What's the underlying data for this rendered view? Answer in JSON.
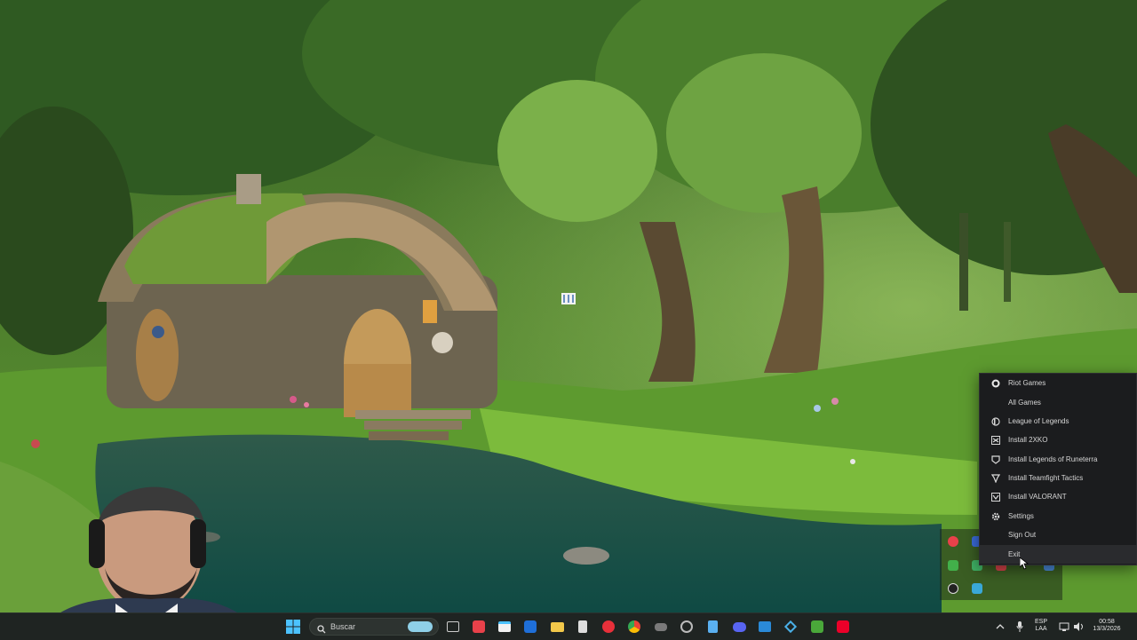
{
  "menu": {
    "items": [
      {
        "label": "Riot Games",
        "icon": "riot-fist-icon"
      },
      {
        "label": "All Games",
        "icon": ""
      },
      {
        "label": "League of Legends",
        "icon": "league-icon"
      },
      {
        "label": "Install 2XKO",
        "icon": "2xko-icon"
      },
      {
        "label": "Install Legends of Runeterra",
        "icon": "runeterra-icon"
      },
      {
        "label": "Install Teamfight Tactics",
        "icon": "tft-icon"
      },
      {
        "label": "Install VALORANT",
        "icon": "valorant-icon"
      },
      {
        "label": "Settings",
        "icon": "gear-icon"
      },
      {
        "label": "Sign Out",
        "icon": ""
      },
      {
        "label": "Exit",
        "icon": ""
      }
    ]
  },
  "taskbar": {
    "search_label": "Buscar",
    "language_line1": "ESP",
    "language_line2": "LAA",
    "time": "00:58",
    "date": "13/3/2026"
  },
  "colors": {
    "menu_bg": "#1b1c1e",
    "riot_red": "#eb0029",
    "taskbar_bg": "#1f2422"
  }
}
